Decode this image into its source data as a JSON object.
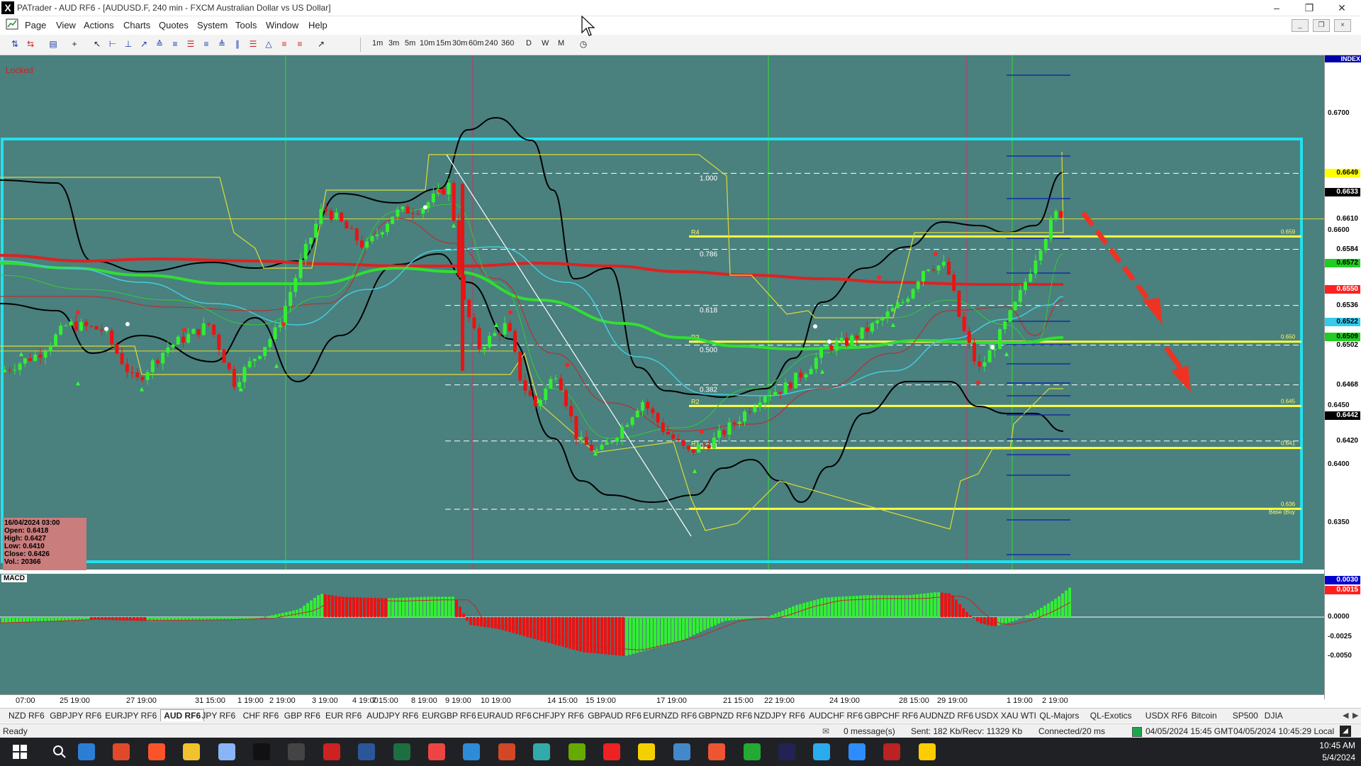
{
  "window": {
    "app_icon": "X",
    "title": "PATrader - AUD RF6 - [AUDUSD.F, 240 min - FXCM Australian Dollar vs US Dollar]",
    "controls": [
      "minimize-icon",
      "restore-icon",
      "close-icon"
    ]
  },
  "menu": {
    "items": [
      "Page",
      "View",
      "Actions",
      "Charts",
      "Quotes",
      "System",
      "Tools",
      "Window",
      "Help"
    ]
  },
  "toolbar": {
    "timeframes": [
      "1m",
      "3m",
      "5m",
      "10m",
      "15m",
      "30m",
      "60m",
      "240",
      "360",
      "D",
      "W",
      "M"
    ]
  },
  "chart": {
    "locked_label": "Locked",
    "index_label": "INDEX",
    "fib_levels": [
      "1.000",
      "0.786",
      "0.618",
      "0.500",
      "0.382",
      "0.214"
    ],
    "pivot_labels": [
      "R4",
      "R3",
      "R2",
      "R1"
    ],
    "right_labels": [
      "0.659",
      "0.650",
      "0.645",
      "0.641",
      "0.636",
      "Base (Buy"
    ],
    "price_axis_labels": [
      "0.6700",
      "0.6650",
      "0.6600",
      "0.6550",
      "0.6500",
      "0.6450",
      "0.6400",
      "0.6350"
    ],
    "price_tags": [
      {
        "text": "0.6649",
        "bg": "#ffff00",
        "fg": "#000000"
      },
      {
        "text": "0.6633",
        "bg": "#000000",
        "fg": "#ffffff"
      },
      {
        "text": "0.6610",
        "bg": "#ffffff",
        "fg": "#000000"
      },
      {
        "text": "0.6584",
        "bg": "#ffffff",
        "fg": "#000000"
      },
      {
        "text": "0.6572",
        "bg": "#22cc22",
        "fg": "#000000"
      },
      {
        "text": "0.6550",
        "bg": "#ff2020",
        "fg": "#ffffff"
      },
      {
        "text": "0.6536",
        "bg": "#ffffff",
        "fg": "#000000"
      },
      {
        "text": "0.6522",
        "bg": "#33ccee",
        "fg": "#000000"
      },
      {
        "text": "0.6509",
        "bg": "#22cc22",
        "fg": "#000000"
      },
      {
        "text": "0.6502",
        "bg": "#ffffff",
        "fg": "#000000"
      },
      {
        "text": "0.6468",
        "bg": "#ffffff",
        "fg": "#000000"
      },
      {
        "text": "0.6442",
        "bg": "#000000",
        "fg": "#ffffff"
      },
      {
        "text": "0.6420",
        "bg": "#ffffff",
        "fg": "#000000"
      }
    ],
    "info": {
      "date": "16/04/2024 03:00",
      "open": "Open: 0.6418",
      "high": "High: 0.6427",
      "low": "Low: 0.6410",
      "close": "Close: 0.6426",
      "vol": "Vol.: 20366"
    },
    "colors": {
      "background": "#4a807e",
      "bull": "#33ee33",
      "bear": "#ee1111",
      "bollinger": "#000000",
      "ma_red": "#dd2222",
      "ma_green": "#33dd33",
      "ma_cyan": "#44ccdd",
      "channel": "#ffff44",
      "box": "#22e0ee",
      "arrow": "#ee3322"
    }
  },
  "macd": {
    "label": "MACD",
    "axis_labels": [
      "0.0000",
      "-0.0025",
      "-0.0050"
    ],
    "tags": [
      {
        "text": "0.0030",
        "bg": "#0000cc",
        "fg": "#ffffff"
      },
      {
        "text": "0.0015",
        "bg": "#ff2020",
        "fg": "#ffffff"
      }
    ]
  },
  "time_axis": [
    "07:00",
    "25 19:00",
    "27 19:00",
    "31 15:00",
    "1 19:00",
    "2 19:00",
    "3 19:00",
    "4 19:00",
    "7 15:00",
    "8 19:00",
    "9 19:00",
    "10 19:00",
    "14 15:00",
    "15 19:00",
    "17 19:00",
    "21 15:00",
    "22 19:00",
    "24 19:00",
    "28 15:00",
    "29 19:00",
    "1 19:00",
    "2 19:00"
  ],
  "symbol_tabs": [
    "NZD RF6",
    "GBPJPY RF6",
    "EURJPY RF6",
    "AUD RF6",
    "JPY RF6",
    "CHF RF6",
    "GBP RF6",
    "EUR RF6",
    "AUDJPY RF6",
    "EURGBP RF6",
    "EURAUD RF6",
    "CHFJPY RF6",
    "GBPAUD RF6",
    "EURNZD RF6",
    "GBPNZD RF6",
    "NZDJPY RF6",
    "AUDCHF RF6",
    "GBPCHF RF6",
    "AUDNZD RF6",
    "USDX XAU WTI",
    "QL-Majors",
    "QL-Exotics",
    "USDX RF6",
    "Bitcoin",
    "SP500",
    "DJIA"
  ],
  "active_tab": "AUD RF6",
  "status": {
    "ready": "Ready",
    "messages": "0 message(s)",
    "traffic": "Sent: 182 Kb/Recv: 11329 Kb",
    "connection": "Connected/20 ms",
    "gmt_time": "04/05/2024 15:45 GMT",
    "local_time": "04/05/2024 10:45:29 Local"
  },
  "taskbar": {
    "time": "10:45 AM",
    "date": "5/4/2024",
    "apps": [
      "windows-icon",
      "search-icon",
      "thunderbird-icon",
      "chrome-icon",
      "brave-icon",
      "file-explorer-icon",
      "notepad-icon",
      "ic-markets-icon",
      "calculator-icon",
      "trader-app-icon",
      "word-icon",
      "excel-icon",
      "wps-icon",
      "s-app-icon",
      "powerpoint-icon",
      "forex-app-icon",
      "green-app-icon",
      "red-app-icon",
      "notes-icon",
      "remote-icon",
      "c-app-icon",
      "camtasia-icon",
      "quantower-icon",
      "telegram-icon",
      "zoom-icon",
      "trader2-icon",
      "star-app-icon"
    ]
  }
}
